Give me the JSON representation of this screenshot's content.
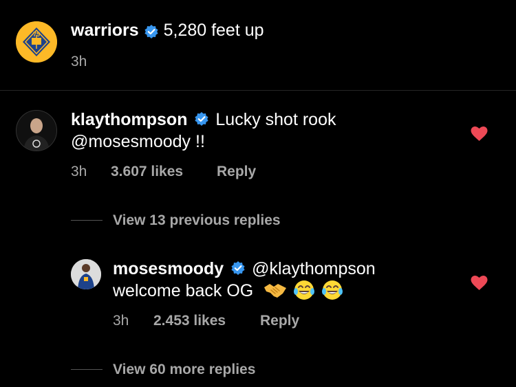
{
  "post": {
    "username": "warriors",
    "caption": "5,280 feet up",
    "time": "3h"
  },
  "comments": [
    {
      "username": "klaythompson",
      "text_line1": "Lucky shot rook",
      "text_line2": "@mosesmoody !!",
      "time": "3h",
      "likes": "3.607 likes",
      "reply_label": "Reply",
      "liked": true
    },
    {
      "username": "mosesmoody",
      "mention": "@klaythompson",
      "text_line2": "welcome back OG",
      "emojis": [
        "handshake",
        "face-with-tears-of-joy",
        "face-with-tears-of-joy"
      ],
      "time": "3h",
      "likes": "2.453 likes",
      "reply_label": "Reply",
      "liked": true
    }
  ],
  "view_previous": "View 13 previous replies",
  "view_more": "View 60 more replies",
  "colors": {
    "background": "#000000",
    "heart": "#ed4956",
    "verified": "#3897f0",
    "meta_text": "#a8a8a8"
  }
}
